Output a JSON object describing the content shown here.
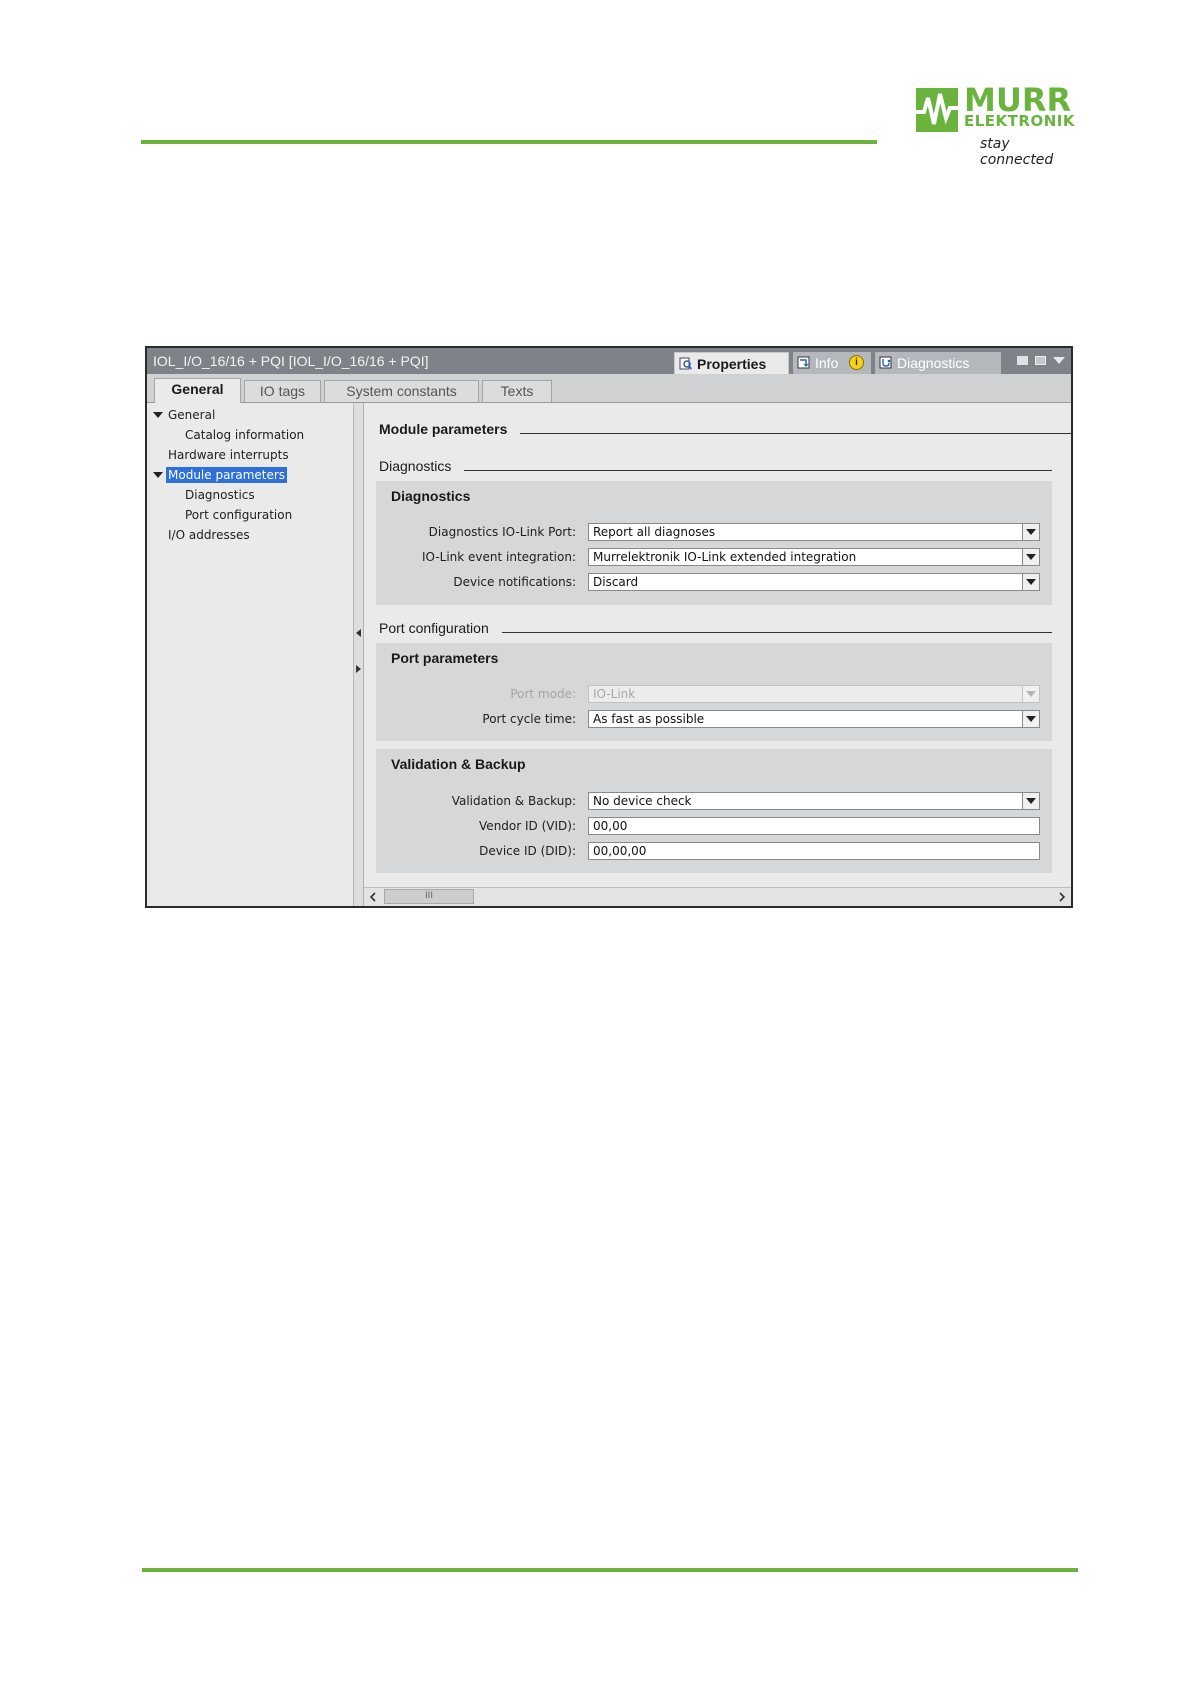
{
  "brand": {
    "name_line1": "MURR",
    "name_line2": "ELEKTRONIK",
    "tagline": "stay connected",
    "color": "#6ab43e"
  },
  "window": {
    "title": "IOL_I/O_16/16 + PQI [IOL_I/O_16/16 + PQI]",
    "top_tabs": [
      {
        "label": "Properties",
        "icon": "properties-icon",
        "active": true
      },
      {
        "label": "Info",
        "icon": "info-icon",
        "active": false
      },
      {
        "label": "Diagnostics",
        "icon": "diagnostics-icon",
        "active": false
      }
    ],
    "info_badge": "i"
  },
  "subtabs": [
    {
      "label": "General",
      "active": true
    },
    {
      "label": "IO tags",
      "active": false
    },
    {
      "label": "System constants",
      "active": false
    },
    {
      "label": "Texts",
      "active": false
    }
  ],
  "nav": [
    {
      "label": "General",
      "level": 0,
      "expanded": true
    },
    {
      "label": "Catalog information",
      "level": 1
    },
    {
      "label": "Hardware interrupts",
      "level": 0
    },
    {
      "label": "Module parameters",
      "level": 0,
      "expanded": true,
      "selected": true
    },
    {
      "label": "Diagnostics",
      "level": 1
    },
    {
      "label": "Port configuration",
      "level": 1
    },
    {
      "label": "I/O addresses",
      "level": 0
    }
  ],
  "content": {
    "main_title": "Module parameters",
    "diagnostics_section": {
      "title": "Diagnostics",
      "group_title": "Diagnostics",
      "fields": [
        {
          "label": "Diagnostics IO-Link Port:",
          "value": "Report all diagnoses",
          "type": "select"
        },
        {
          "label": "IO-Link event integration:",
          "value": "Murrelektronik IO-Link extended integration",
          "type": "select"
        },
        {
          "label": "Device notifications:",
          "value": "Discard",
          "type": "select"
        }
      ]
    },
    "port_section": {
      "title": "Port configuration",
      "port_group": {
        "title": "Port parameters",
        "fields": [
          {
            "label": "Port mode:",
            "value": "IO-Link",
            "type": "select",
            "disabled": true
          },
          {
            "label": "Port cycle time:",
            "value": "As fast as possible",
            "type": "select"
          }
        ]
      },
      "validation_group": {
        "title": "Validation & Backup",
        "fields": [
          {
            "label": "Validation & Backup:",
            "value": "No device check",
            "type": "select"
          },
          {
            "label": "Vendor ID (VID):",
            "value": "00,00",
            "type": "text"
          },
          {
            "label": "Device ID (DID):",
            "value": "00,00,00",
            "type": "text"
          }
        ]
      }
    }
  },
  "scrollbar": {
    "thumb_label": "III"
  }
}
